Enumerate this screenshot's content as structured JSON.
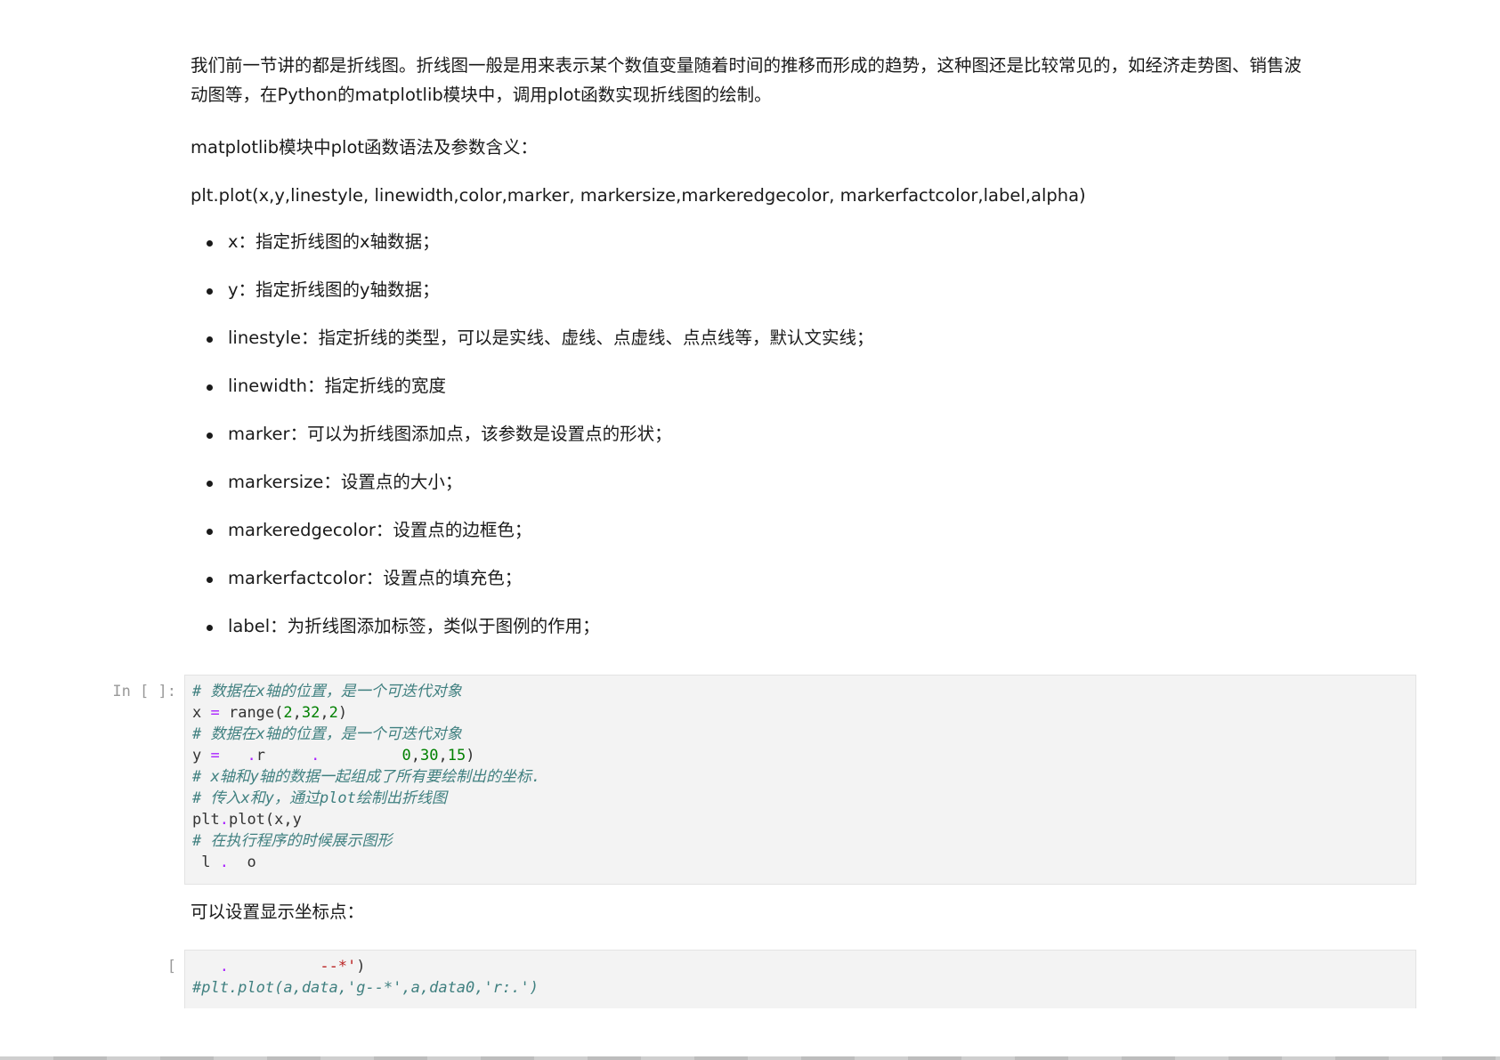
{
  "markdown": {
    "intro_line1": "我们前一节讲的都是折线图。折线图一般是用来表示某个数值变量随着时间的推移而形成的趋势，这种图还是比较常见的，如经济走势图、销售波",
    "intro_line2": "动图等，在Python的matplotlib模块中，调用plot函数实现折线图的绘制。",
    "syntax_title": "matplotlib模块中plot函数语法及参数含义：",
    "syntax_signature": "plt.plot(x,y,linestyle, linewidth,color,marker, markersize,markeredgecolor, markerfactcolor,label,alpha)",
    "params": [
      "x：指定折线图的x轴数据；",
      "y：指定折线图的y轴数据；",
      "linestyle：指定折线的类型，可以是实线、虚线、点虚线、点点线等，默认文实线；",
      "linewidth：指定折线的宽度",
      "marker：可以为折线图添加点，该参数是设置点的形状；",
      "markersize：设置点的大小；",
      "markeredgecolor：设置点的边框色；",
      "markerfactcolor：设置点的填充色；",
      "label：为折线图添加标签，类似于图例的作用；"
    ],
    "after_code_note": "可以设置显示坐标点："
  },
  "cells": [
    {
      "prompt": "In [ ]:",
      "lines": [
        [
          {
            "t": "comment",
            "v": "# 数据在x轴的位置，是一个可迭代对象"
          }
        ],
        [
          {
            "t": "plain",
            "v": "x "
          },
          {
            "t": "op",
            "v": "="
          },
          {
            "t": "plain",
            "v": " range("
          },
          {
            "t": "num",
            "v": "2"
          },
          {
            "t": "plain",
            "v": ","
          },
          {
            "t": "num",
            "v": "32"
          },
          {
            "t": "plain",
            "v": ","
          },
          {
            "t": "num",
            "v": "2"
          },
          {
            "t": "plain",
            "v": ")"
          }
        ],
        [
          {
            "t": "comment",
            "v": "# 数据在x轴的位置，是一个可迭代对象"
          }
        ],
        [
          {
            "t": "plain",
            "v": "y "
          },
          {
            "t": "op",
            "v": "="
          },
          {
            "t": "plain",
            "v": "   "
          },
          {
            "t": "op",
            "v": "."
          },
          {
            "t": "plain",
            "v": "r     "
          },
          {
            "t": "op",
            "v": "."
          },
          {
            "t": "plain",
            "v": "         "
          },
          {
            "t": "num",
            "v": "0"
          },
          {
            "t": "plain",
            "v": ","
          },
          {
            "t": "num",
            "v": "30"
          },
          {
            "t": "plain",
            "v": ","
          },
          {
            "t": "num",
            "v": "15"
          },
          {
            "t": "plain",
            "v": ")"
          }
        ],
        [
          {
            "t": "comment",
            "v": "# x轴和y轴的数据一起组成了所有要绘制出的坐标."
          }
        ],
        [
          {
            "t": "comment",
            "v": "# 传入x和y，通过plot绘制出折线图"
          }
        ],
        [
          {
            "t": "plain",
            "v": "plt"
          },
          {
            "t": "op",
            "v": "."
          },
          {
            "t": "plain",
            "v": "plot(x,y"
          }
        ],
        [
          {
            "t": "comment",
            "v": "# 在执行程序的时候展示图形"
          }
        ],
        [
          {
            "t": "plain",
            "v": " l "
          },
          {
            "t": "op",
            "v": "."
          },
          {
            "t": "plain",
            "v": "  o"
          }
        ]
      ]
    },
    {
      "prompt": "[",
      "lines": [
        [
          {
            "t": "plain",
            "v": "   "
          },
          {
            "t": "op",
            "v": "."
          },
          {
            "t": "plain",
            "v": "          "
          },
          {
            "t": "str",
            "v": "--*'"
          },
          {
            "t": "plain",
            "v": ")"
          }
        ],
        [
          {
            "t": "comment",
            "v": "#plt.plot(a,data,'g--*',a,data0,'r:.')"
          }
        ]
      ]
    }
  ]
}
